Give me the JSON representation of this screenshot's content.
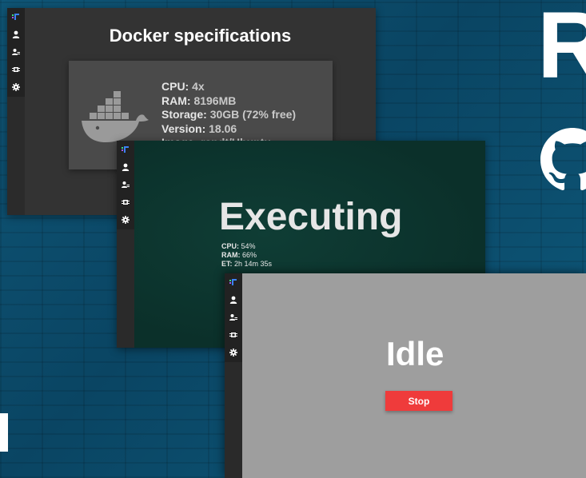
{
  "colors": {
    "background": "#0c4a6a",
    "stop_button": "#ef3b3b",
    "logo_green": "#3ddc84",
    "logo_blue": "#3b82f6",
    "logo_purple": "#a855f7"
  },
  "background_decor": {
    "letter": "R",
    "icon": "github-icon"
  },
  "sidebar": {
    "icons": [
      "app-logo-icon",
      "user-icon",
      "user-management-icon",
      "cpu-chip-icon",
      "gear-icon"
    ]
  },
  "docker_window": {
    "title": "Docker specifications",
    "icon": "docker-whale-icon",
    "specs": [
      {
        "label": "CPU:",
        "value": "4x"
      },
      {
        "label": "RAM:",
        "value": "8196MB"
      },
      {
        "label": "Storage:",
        "value": "30GB (72% free)"
      },
      {
        "label": "Version:",
        "value": "18.06"
      },
      {
        "label": "Image:",
        "value": "randt/Ubuntu"
      }
    ]
  },
  "executing_window": {
    "status": "Executing",
    "stats": [
      {
        "label": "CPU:",
        "value": "54%"
      },
      {
        "label": "RAM:",
        "value": "66%"
      },
      {
        "label": "ET:",
        "value": "2h 14m 35s"
      }
    ]
  },
  "idle_window": {
    "status": "Idle",
    "stop_label": "Stop"
  }
}
